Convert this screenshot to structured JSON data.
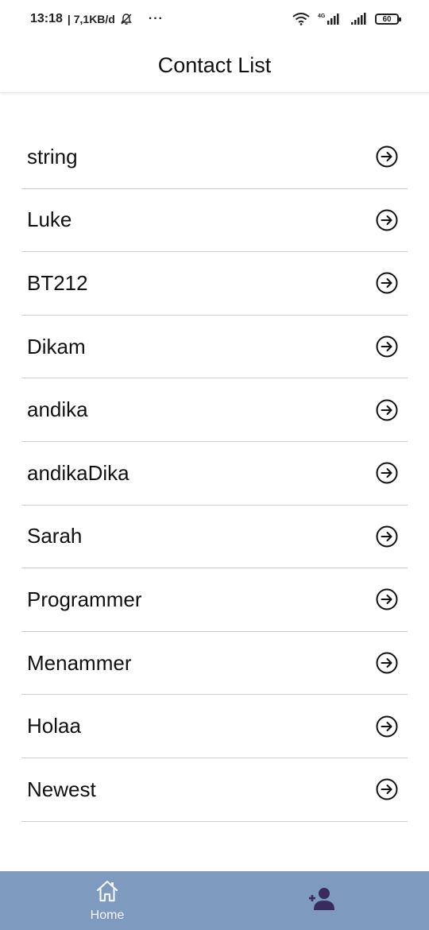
{
  "status_bar": {
    "time": "13:18",
    "speed": "| 7,1KB/d",
    "dots": "···",
    "network": "4G",
    "battery": "60"
  },
  "header": {
    "title": "Contact List"
  },
  "contacts": [
    {
      "name": "string"
    },
    {
      "name": "Luke"
    },
    {
      "name": "BT212"
    },
    {
      "name": "Dikam"
    },
    {
      "name": "andika"
    },
    {
      "name": "andikaDika"
    },
    {
      "name": "Sarah"
    },
    {
      "name": "Programmer"
    },
    {
      "name": "Menammer"
    },
    {
      "name": "Holaa"
    },
    {
      "name": "Newest"
    }
  ],
  "bottom_nav": {
    "home_label": "Home",
    "home_icon": "home-icon",
    "add_contact_icon": "add-person-icon"
  },
  "colors": {
    "nav_background": "#7e9bbf",
    "add_contact_icon": "#3a2a5e",
    "divider": "#cfcfcf"
  }
}
